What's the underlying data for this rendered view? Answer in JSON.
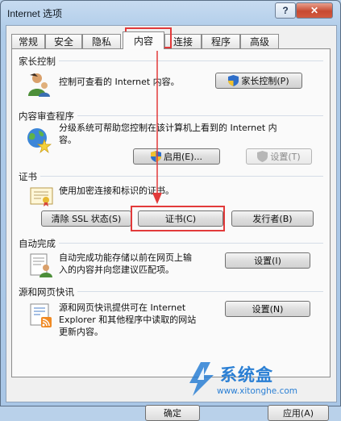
{
  "window": {
    "title": "Internet 选项",
    "help_label": "?",
    "close_label": "✕"
  },
  "tabs": [
    {
      "label": "常规"
    },
    {
      "label": "安全"
    },
    {
      "label": "隐私"
    },
    {
      "label": "内容"
    },
    {
      "label": "连接"
    },
    {
      "label": "程序"
    },
    {
      "label": "高级"
    }
  ],
  "active_tab": "内容",
  "parental": {
    "title": "家长控制",
    "description": "控制可查看的 Internet 内容。",
    "button": "家长控制(P)"
  },
  "content_advisor": {
    "title": "内容审查程序",
    "description_line1": "分级系统可帮助您控制在该计算机上看到的 Internet 内",
    "description_line2": "容。",
    "enable_button": "启用(E)...",
    "settings_button": "设置(T)"
  },
  "certificates": {
    "title": "证书",
    "description": "使用加密连接和标识的证书。",
    "clear_ssl_button": "清除 SSL 状态(S)",
    "certificates_button": "证书(C)",
    "publishers_button": "发行者(B)"
  },
  "autocomplete": {
    "title": "自动完成",
    "description_line1": "自动完成功能存储以前在网页上输",
    "description_line2": "入的内容并向您建议匹配项。",
    "settings_button": "设置(I)"
  },
  "feeds": {
    "title": "源和网页快讯",
    "description_line1": "源和网页快讯提供可在 Internet",
    "description_line2": "Explorer 和其他程序中读取的网站",
    "description_line3": "更新内容。",
    "settings_button": "设置(N)"
  },
  "footer": {
    "ok_button": "确定",
    "apply_button": "应用(A)"
  },
  "watermark": {
    "brand": "系统盒",
    "url": "www.xitonghe.com"
  },
  "colors": {
    "annotation": "#e23a3a",
    "accent": "#2a7fd4"
  }
}
